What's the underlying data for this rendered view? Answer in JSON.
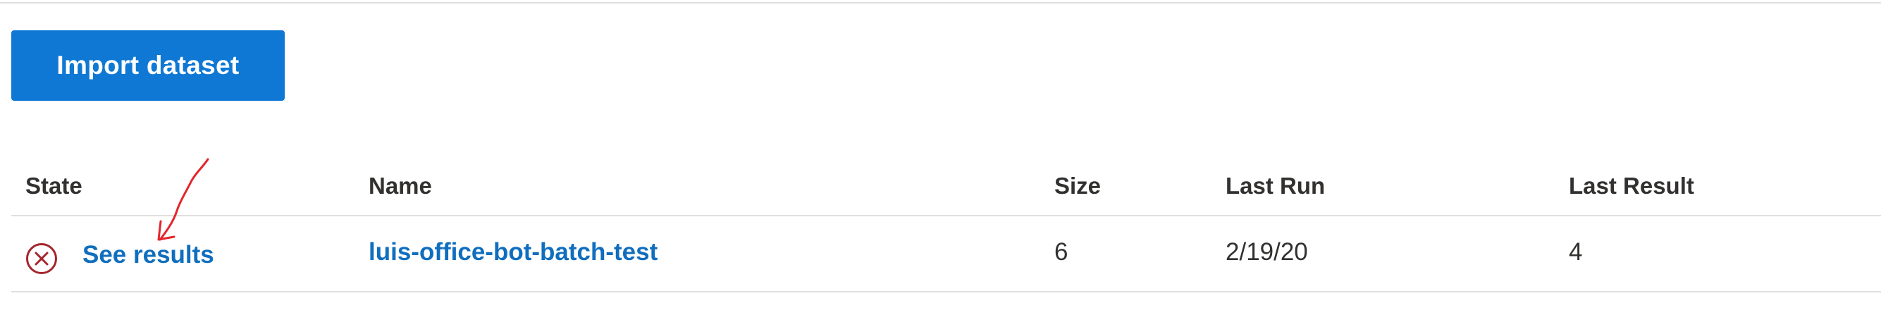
{
  "toolbar": {
    "import_button_label": "Import dataset",
    "accent_color": "#0f78d4"
  },
  "table": {
    "columns": [
      "State",
      "Name",
      "Size",
      "Last Run",
      "Last Result"
    ],
    "rows": [
      {
        "state_icon": "error-circle-x-icon",
        "state_color": "#a4262c",
        "state_link": "See results",
        "name": "luis-office-bot-batch-test",
        "size": "6",
        "last_run": "2/19/20",
        "last_result": "4"
      }
    ]
  },
  "annotation": {
    "icon": "red-hand-drawn-arrow",
    "color": "#e3262b"
  }
}
